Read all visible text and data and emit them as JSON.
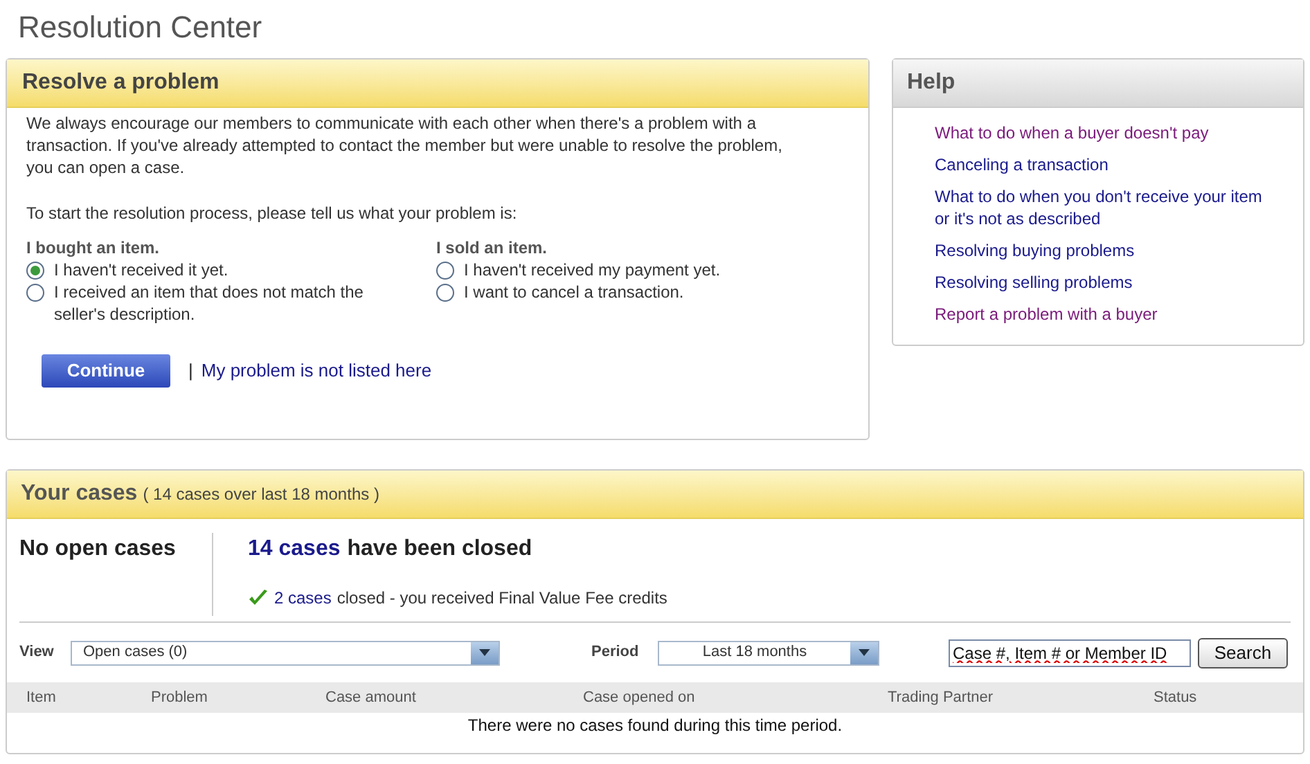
{
  "page_title": "Resolution Center",
  "resolve": {
    "title": "Resolve a problem",
    "intro": "We always encourage our members to communicate with each other when there's a problem with a transaction. If you've already attempted to contact the member but were unable to resolve the problem, you can open a case.",
    "prompt": "To start the resolution process, please tell us what your problem is:",
    "groups": [
      {
        "heading": "I bought an item.",
        "options": [
          {
            "label": "I haven't received it yet.",
            "selected": true
          },
          {
            "label": "I received an item that does not match the seller's description.",
            "selected": false
          }
        ]
      },
      {
        "heading": "I sold an item.",
        "options": [
          {
            "label": "I haven't received my payment yet.",
            "selected": false
          },
          {
            "label": "I want to cancel a transaction.",
            "selected": false
          }
        ]
      }
    ],
    "continue_button": "Continue",
    "separator": "|",
    "not_listed_link": "My problem is not listed here"
  },
  "help": {
    "title": "Help",
    "links": [
      {
        "label": "What to do when a buyer doesn't pay",
        "visited": true
      },
      {
        "label": "Canceling a transaction",
        "visited": false
      },
      {
        "label": "What to do when you don't receive your item or it's not as described",
        "visited": false
      },
      {
        "label": "Resolving buying problems",
        "visited": false
      },
      {
        "label": "Resolving selling problems",
        "visited": false
      },
      {
        "label": "Report a problem with a buyer",
        "visited": true
      }
    ]
  },
  "cases": {
    "title": "Your cases",
    "subtitle": "( 14 cases over last 18 months )",
    "open_summary": "No open cases",
    "closed_link": "14 cases",
    "closed_text": "have been closed",
    "credits_link": "2 cases",
    "credits_text": "closed - you received Final Value Fee credits",
    "view_label": "View",
    "view_value": "Open cases (0)",
    "period_label": "Period",
    "period_value": "Last 18 months",
    "search_value": "Case #, Item # or Member ID",
    "search_button": "Search",
    "columns": [
      "Item",
      "Problem",
      "Case amount",
      "Case opened on",
      "Trading Partner",
      "Status"
    ],
    "empty_message": "There were no cases found during this time period."
  }
}
